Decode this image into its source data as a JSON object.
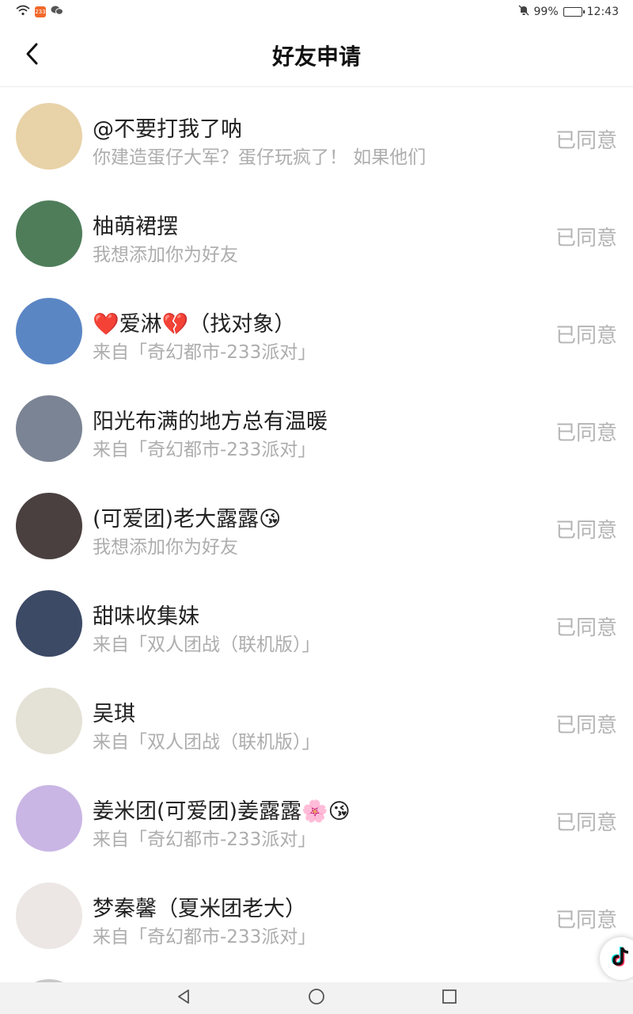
{
  "status_bar": {
    "app_badge": "233",
    "battery": "99%",
    "battery_level": 0.99,
    "time": "12:43"
  },
  "header": {
    "title": "好友申请"
  },
  "friends": [
    {
      "name": "@不要打我了呐",
      "message": "你建造蛋仔大军？蛋仔玩疯了！ 如果他们",
      "status": "已同意",
      "avatar_color": "#e8d2a8"
    },
    {
      "name": "柚萌裙摆",
      "message": "我想添加你为好友",
      "status": "已同意",
      "avatar_color": "#4f7d5a"
    },
    {
      "name": "❤️爱淋💔（找对象）",
      "message": "来自「奇幻都市-233派对」",
      "status": "已同意",
      "avatar_color": "#5b86c4"
    },
    {
      "name": "阳光布满的地方总有温暖",
      "message": "来自「奇幻都市-233派对」",
      "status": "已同意",
      "avatar_color": "#7b8494"
    },
    {
      "name": "(可爱团)老大露露😘",
      "message": "我想添加你为好友",
      "status": "已同意",
      "avatar_color": "#4a4040"
    },
    {
      "name": "甜味收集妹",
      "message": "来自「双人团战（联机版）」",
      "status": "已同意",
      "avatar_color": "#3d4a66"
    },
    {
      "name": "吴琪",
      "message": "来自「双人团战（联机版）」",
      "status": "已同意",
      "avatar_color": "#e4e2d6"
    },
    {
      "name": "姜米团(可爱团)姜露露🌸😘",
      "message": "来自「奇幻都市-233派对」",
      "status": "已同意",
      "avatar_color": "#c9b6e4"
    },
    {
      "name": "梦秦馨（夏米团老大）",
      "message": "来自「奇幻都市-233派对」",
      "status": "已同意",
      "avatar_color": "#ece7e4"
    }
  ],
  "icons": {
    "back": "back-arrow-icon",
    "floating": "tiktok-icon",
    "nav_back": "triangle-back-icon",
    "nav_home": "circle-home-icon",
    "nav_recent": "square-recent-icon"
  }
}
